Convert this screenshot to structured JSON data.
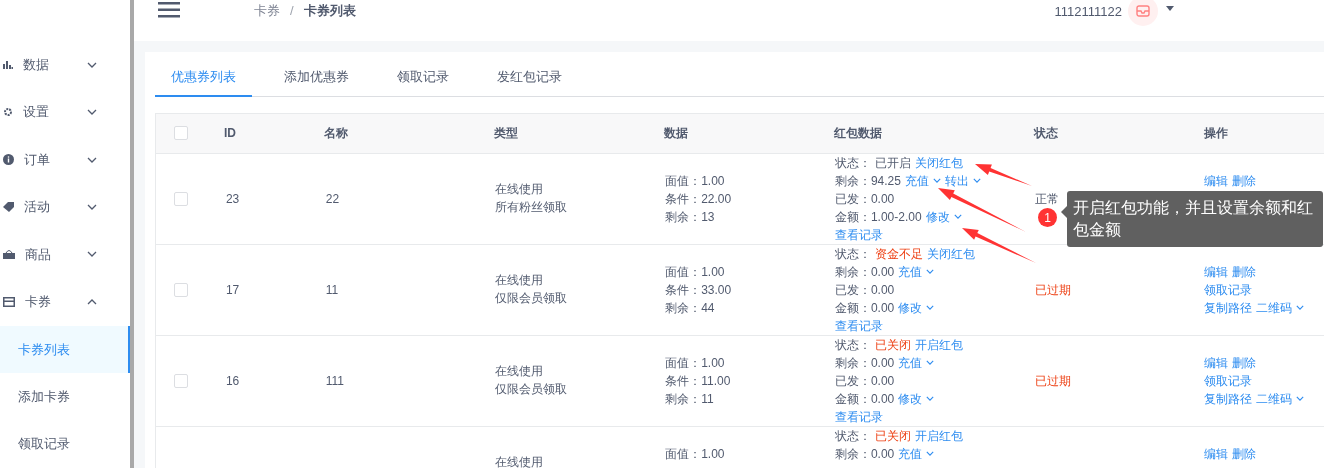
{
  "header": {
    "breadcrumb": [
      "卡券",
      "卡券列表"
    ],
    "separator": "/",
    "username": "1112111122"
  },
  "sidebar": {
    "items": [
      {
        "label": "数据",
        "expanded": false
      },
      {
        "label": "设置",
        "expanded": false
      },
      {
        "label": "订单",
        "expanded": false
      },
      {
        "label": "活动",
        "expanded": false
      },
      {
        "label": "商品",
        "expanded": false
      },
      {
        "label": "卡券",
        "expanded": true,
        "children": [
          {
            "label": "卡券列表",
            "selected": true
          },
          {
            "label": "添加卡券",
            "selected": false
          },
          {
            "label": "领取记录",
            "selected": false
          }
        ]
      }
    ]
  },
  "tabs": [
    {
      "label": "优惠券列表",
      "selected": true
    },
    {
      "label": "添加优惠券",
      "selected": false
    },
    {
      "label": "领取记录",
      "selected": false
    },
    {
      "label": "发红包记录",
      "selected": false
    }
  ],
  "table": {
    "select_all_checked": false,
    "columns": [
      "ID",
      "名称",
      "类型",
      "数据",
      "红包数据",
      "状态",
      "操作"
    ],
    "rows": [
      {
        "checked": false,
        "id": "23",
        "name": "22",
        "type": [
          "在线使用",
          "所有粉丝领取"
        ],
        "data": [
          "面值：1.00",
          "条件：22.00",
          "剩余：13"
        ],
        "redpacket": {
          "status_label": "状态：",
          "status": "已开启",
          "status_alert": false,
          "toggle": "关闭红包",
          "balance": "剩余：94.25",
          "recharge": "充值",
          "transfer": "转出",
          "issued": "已发：0.00",
          "amount": "金额：1.00-2.00",
          "modify": "修改",
          "records": "查看记录"
        },
        "status": {
          "text": "正常",
          "expired": false
        },
        "actions": [
          [
            "编辑",
            "删除"
          ]
        ]
      },
      {
        "checked": false,
        "id": "17",
        "name": "11",
        "type": [
          "在线使用",
          "仅限会员领取"
        ],
        "data": [
          "面值：1.00",
          "条件：33.00",
          "剩余：44"
        ],
        "redpacket": {
          "status_label": "状态：",
          "status": "资金不足",
          "status_alert": true,
          "toggle": "关闭红包",
          "balance": "剩余：0.00",
          "recharge": "充值",
          "issued": "已发：0.00",
          "amount": "金额：0.00",
          "modify": "修改",
          "records": "查看记录"
        },
        "status": {
          "text": "已过期",
          "expired": true
        },
        "actions": [
          [
            "编辑",
            "删除"
          ],
          [
            "领取记录"
          ],
          [
            "复制路径",
            "二维码"
          ]
        ]
      },
      {
        "checked": false,
        "id": "16",
        "name": "111",
        "type": [
          "在线使用",
          "仅限会员领取"
        ],
        "data": [
          "面值：1.00",
          "条件：11.00",
          "剩余：11"
        ],
        "redpacket": {
          "status_label": "状态：",
          "status": "已关闭",
          "status_alert": true,
          "toggle": "开启红包",
          "balance": "剩余：0.00",
          "recharge": "充值",
          "issued": "已发：0.00",
          "amount": "金额：0.00",
          "modify": "修改",
          "records": "查看记录"
        },
        "status": {
          "text": "已过期",
          "expired": true
        },
        "actions": [
          [
            "编辑",
            "删除"
          ],
          [
            "领取记录"
          ],
          [
            "复制路径",
            "二维码"
          ]
        ]
      },
      {
        "type": [
          "在线使用"
        ],
        "data": [
          "面值：1.00"
        ],
        "redpacket": {
          "status_label": "状态：",
          "status": "已关闭",
          "status_alert": true,
          "toggle": "开启红包",
          "balance": "剩余：0.00",
          "recharge": "充值"
        },
        "actions": [
          [
            "编辑",
            "删除"
          ]
        ]
      }
    ]
  },
  "annotation": {
    "number": "1",
    "text": "开启红包功能，并且设置余额和红包金额"
  }
}
